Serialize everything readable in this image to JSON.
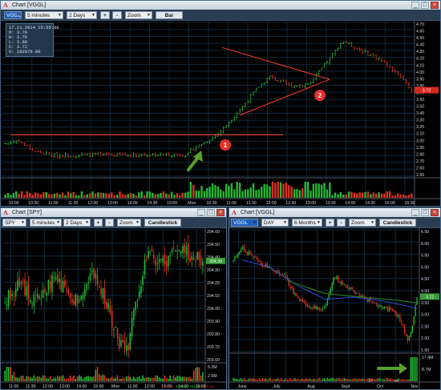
{
  "top": {
    "window_title": "Chart [VGGL]",
    "symbol": "VGGL",
    "interval": "5 minutes",
    "range": "2 Days",
    "plus": "+",
    "minus": "-",
    "zoom": "Zoom",
    "type": "Bar",
    "info": {
      "date": "17.11.2014 15:55:00",
      "open": "O: 3.76",
      "high": "H: 3.76",
      "low": "L: 3.68",
      "close": "C: 3.72",
      "volume": "V: 182876.00"
    },
    "annotation_1": "1",
    "annotation_2": "2",
    "price_labels": [
      "4.70",
      "4.60",
      "4.50",
      "4.40",
      "4.30",
      "4.20",
      "4.10",
      "4.00",
      "3.90",
      "3.80",
      "3.70",
      "3.60",
      "3.50",
      "3.40",
      "3.30",
      "3.20",
      "3.10",
      "3.00",
      "2.90",
      "2.80",
      "2.70",
      "2.60",
      "2.50"
    ],
    "last_price": "3.72",
    "time_labels": [
      "10:00",
      "10:30",
      "11:00",
      "11:30",
      "12:00",
      "13:00",
      "14:00",
      "14:30",
      "15:00",
      "Mon",
      "10:30",
      "11:00",
      "11:30",
      "12:00",
      "12:30",
      "13:00",
      "13:30",
      "14:00",
      "14:30",
      "15:00",
      "15:30"
    ]
  },
  "spy": {
    "window_title": "Chart [SPY]",
    "symbol": "SPY",
    "interval": "5 minutes",
    "range": "2 Days",
    "plus": "+",
    "minus": "-",
    "zoom": "Zoom",
    "type": "Candlestick",
    "price_labels": [
      "204.60",
      "204.50",
      "204.40",
      "204.30",
      "204.20",
      "204.10",
      "204.00",
      "203.90",
      "203.80",
      "203.70",
      "203.60"
    ],
    "last_price": "204.39",
    "vol_labels": [
      "5.2M",
      "2.6M"
    ],
    "time_labels": [
      "11:00",
      "11:30",
      "12:00",
      "13:00",
      "14:00",
      "15:00",
      "Mon",
      "11:00",
      "12:00",
      "13:00",
      "14:00",
      "15:00"
    ],
    "bottom_values": [
      "204.44",
      "204.44",
      "204.44",
      "204.43"
    ]
  },
  "vggl_daily": {
    "window_title": "Chart [VGGL]",
    "symbol": "VGGL",
    "interval": "DAY",
    "range": "6 Months",
    "plus": "+",
    "minus": "-",
    "zoom": "Zoom",
    "type": "Candlestick",
    "price_labels": [
      "6.50",
      "6.00",
      "5.50",
      "5.00",
      "4.50",
      "4.00",
      "3.50",
      "3.00",
      "2.50",
      "2.00",
      "1.50"
    ],
    "last_price": "3.72",
    "vol_labels": [
      "17.4M",
      "8.7M"
    ],
    "time_labels": [
      "June",
      "July",
      "Aug",
      "Sept",
      "Oct",
      "Nov"
    ],
    "date_labels": [
      "17",
      "16"
    ]
  },
  "colors": {
    "up": "#22bb33",
    "down": "#dd3322",
    "annotation": "#e8302a",
    "arrow": "#5aa02c",
    "trend": "#ff3b2b",
    "grid": "#10283a"
  }
}
